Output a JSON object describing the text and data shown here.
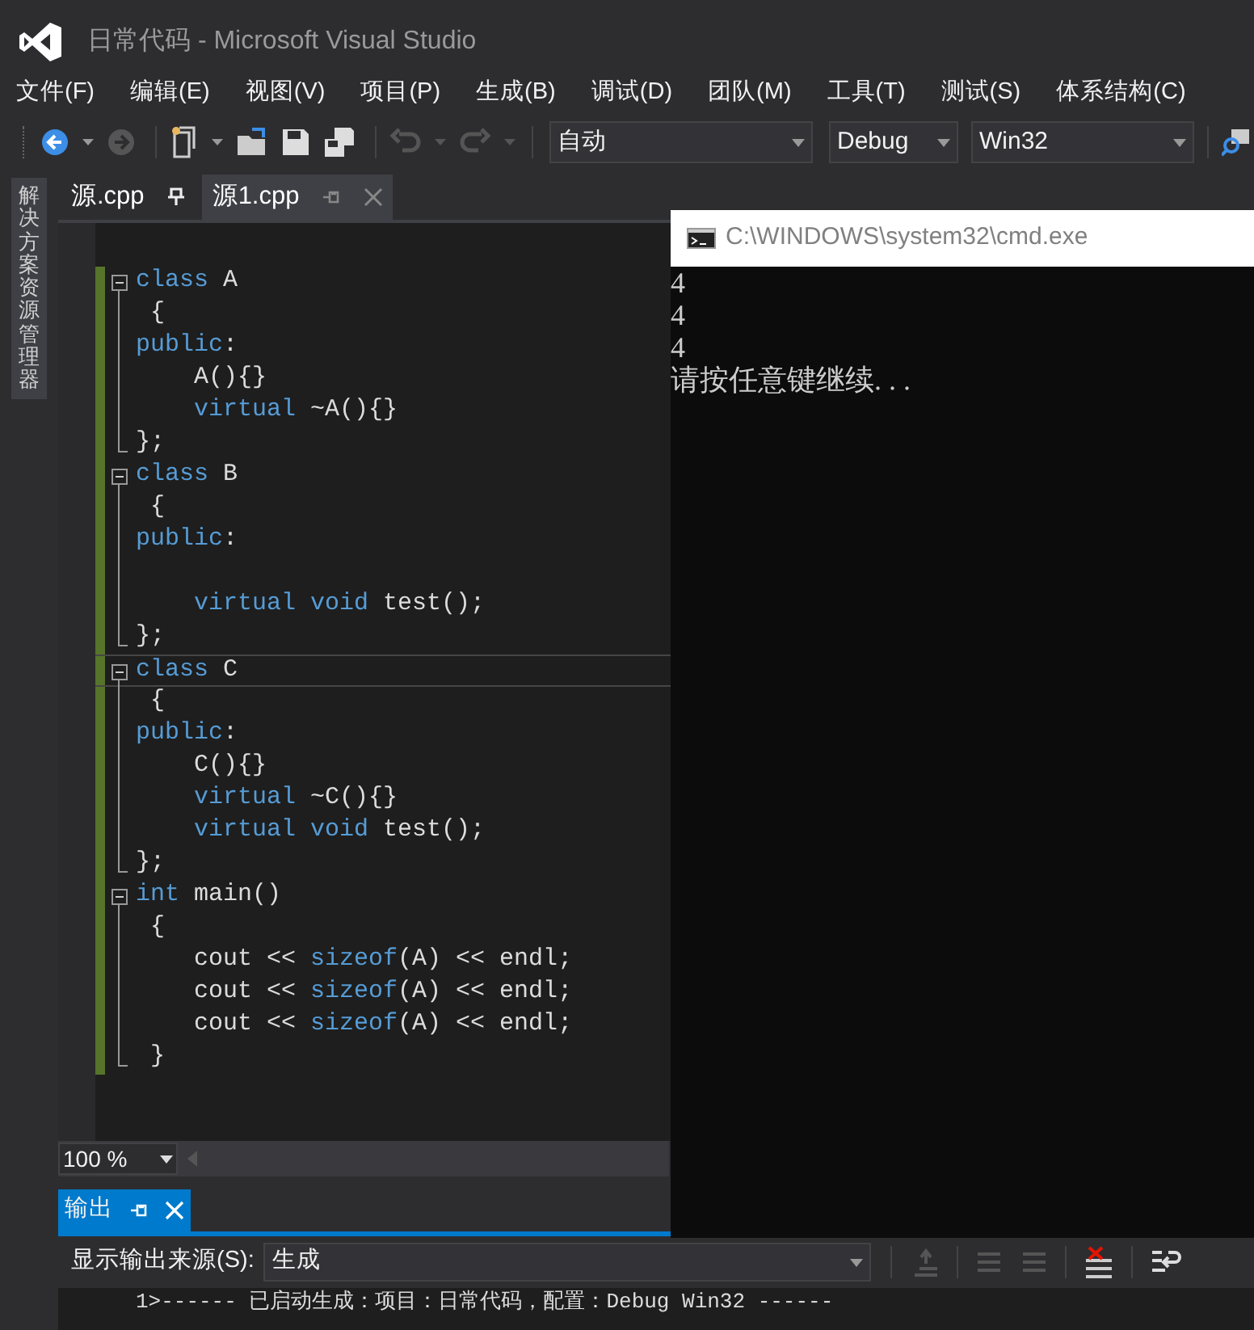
{
  "window": {
    "title": "日常代码 - Microsoft Visual Studio"
  },
  "menu": [
    "文件(F)",
    "编辑(E)",
    "视图(V)",
    "项目(P)",
    "生成(B)",
    "调试(D)",
    "团队(M)",
    "工具(T)",
    "测试(S)",
    "体系结构(C)"
  ],
  "toolbar": {
    "solution_config": "自动",
    "configuration": "Debug",
    "platform": "Win32"
  },
  "side_panel": {
    "label": "解决方案资源管理器"
  },
  "tabs": [
    {
      "label": "源.cpp",
      "selected": false
    },
    {
      "label": "源1.cpp",
      "selected": true
    }
  ],
  "editor": {
    "zoom": "100 %",
    "lines": [
      {
        "changed": false,
        "current": false
      },
      {
        "changed": true,
        "current": false,
        "tokens": [
          {
            "kind": "kw",
            "text": "class"
          },
          {
            "kind": "text",
            "text": " A"
          }
        ],
        "children": [
          {
            "changed": true,
            "current": false,
            "tokens": [
              {
                "kind": "text",
                "text": " {"
              }
            ]
          },
          {
            "changed": true,
            "current": false,
            "tokens": [
              {
                "kind": "kw",
                "text": "public"
              },
              {
                "kind": "text",
                "text": ":"
              }
            ]
          },
          {
            "changed": true,
            "current": false,
            "tokens": [
              {
                "kind": "text",
                "text": "    A(){}"
              }
            ]
          },
          {
            "changed": true,
            "current": false,
            "tokens": [
              {
                "kind": "kw",
                "text": "    virtual"
              },
              {
                "kind": "text",
                "text": " ~A(){}"
              }
            ]
          },
          {
            "changed": true,
            "current": false,
            "tokens": [
              {
                "kind": "text",
                "text": "};"
              }
            ]
          }
        ]
      },
      {
        "changed": true,
        "current": false,
        "tokens": [
          {
            "kind": "kw",
            "text": "class"
          },
          {
            "kind": "text",
            "text": " B"
          }
        ],
        "children": [
          {
            "changed": true,
            "current": false,
            "tokens": [
              {
                "kind": "text",
                "text": " {"
              }
            ]
          },
          {
            "changed": true,
            "current": false,
            "tokens": [
              {
                "kind": "kw",
                "text": "public"
              },
              {
                "kind": "text",
                "text": ":"
              }
            ]
          },
          {
            "changed": true,
            "current": false
          },
          {
            "changed": true,
            "current": false,
            "tokens": [
              {
                "kind": "kw",
                "text": "    virtual void"
              },
              {
                "kind": "text",
                "text": " test();"
              }
            ]
          },
          {
            "changed": true,
            "current": false,
            "tokens": [
              {
                "kind": "text",
                "text": "};"
              }
            ]
          }
        ]
      },
      {
        "changed": true,
        "current": true,
        "tokens": [
          {
            "kind": "kw",
            "text": "class"
          },
          {
            "kind": "text",
            "text": " C"
          }
        ],
        "children": [
          {
            "changed": true,
            "current": false,
            "tokens": [
              {
                "kind": "text",
                "text": " {"
              }
            ]
          },
          {
            "changed": true,
            "current": false,
            "tokens": [
              {
                "kind": "kw",
                "text": "public"
              },
              {
                "kind": "text",
                "text": ":"
              }
            ]
          },
          {
            "changed": true,
            "current": false,
            "tokens": [
              {
                "kind": "text",
                "text": "    C(){}"
              }
            ]
          },
          {
            "changed": true,
            "current": false,
            "tokens": [
              {
                "kind": "kw",
                "text": "    virtual"
              },
              {
                "kind": "text",
                "text": " ~C(){}"
              }
            ]
          },
          {
            "changed": true,
            "current": false,
            "tokens": [
              {
                "kind": "kw",
                "text": "    virtual void"
              },
              {
                "kind": "text",
                "text": " test();"
              }
            ]
          },
          {
            "changed": true,
            "current": false,
            "tokens": [
              {
                "kind": "text",
                "text": "};"
              }
            ]
          }
        ]
      },
      {
        "changed": true,
        "current": false,
        "tokens": [
          {
            "kind": "kw",
            "text": "int"
          },
          {
            "kind": "text",
            "text": " main()"
          }
        ],
        "children": [
          {
            "changed": true,
            "current": false,
            "tokens": [
              {
                "kind": "text",
                "text": " {"
              }
            ]
          },
          {
            "changed": true,
            "current": false,
            "tokens": [
              {
                "kind": "text",
                "text": "    cout << "
              },
              {
                "kind": "kw",
                "text": "sizeof"
              },
              {
                "kind": "text",
                "text": "(A) << endl;"
              }
            ]
          },
          {
            "changed": true,
            "current": false,
            "tokens": [
              {
                "kind": "text",
                "text": "    cout << "
              },
              {
                "kind": "kw",
                "text": "sizeof"
              },
              {
                "kind": "text",
                "text": "(A) << endl;"
              }
            ]
          },
          {
            "changed": true,
            "current": false,
            "tokens": [
              {
                "kind": "text",
                "text": "    cout << "
              },
              {
                "kind": "kw",
                "text": "sizeof"
              },
              {
                "kind": "text",
                "text": "(A) << endl;"
              }
            ]
          },
          {
            "changed": true,
            "current": false,
            "tokens": [
              {
                "kind": "text",
                "text": " }"
              }
            ]
          }
        ]
      }
    ]
  },
  "console": {
    "title": "C:\\WINDOWS\\system32\\cmd.exe",
    "lines": [
      "4",
      "4",
      "4",
      "请按任意键继续. . ."
    ]
  },
  "output": {
    "tab": "输出",
    "source_label": "显示输出来源(S):",
    "source": "生成",
    "lines": [
      "1>------ 已启动生成：项目：日常代码，配置：Debug Win32 ------"
    ]
  }
}
